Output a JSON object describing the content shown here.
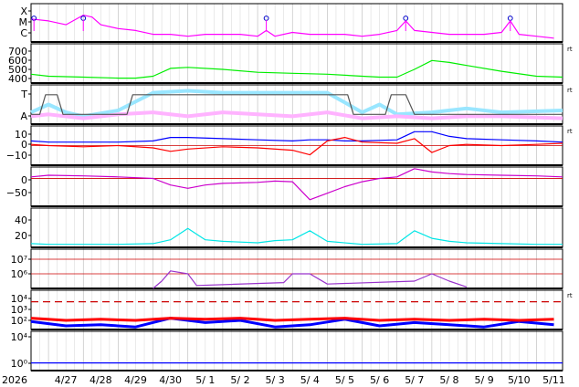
{
  "chart_data": {
    "type": "line",
    "x_axis": {
      "year_label": "2026",
      "start": "2026-04-26T12:00",
      "end": "2026-05-11T18:00",
      "tick_labels": [
        "4/27",
        "4/28",
        "4/29",
        "4/30",
        "5/ 1",
        "5/ 2",
        "5/ 3",
        "5/ 4",
        "5/ 5",
        "5/ 6",
        "5/ 7",
        "5/ 8",
        "5/ 9",
        "5/10",
        "5/11"
      ],
      "grid": true
    },
    "panels": [
      {
        "id": "xray-class",
        "y_tick_labels": [
          "X",
          "M",
          "C"
        ],
        "series": [
          {
            "color": "#ff00ff",
            "x": [
              "2026-04-26T12:00",
              "2026-04-27T00:00",
              "2026-04-27T12:00",
              "2026-04-28T00:00",
              "2026-04-28T06:00",
              "2026-04-28T12:00",
              "2026-04-29T00:00",
              "2026-04-29T12:00",
              "2026-04-30T00:00",
              "2026-04-30T12:00",
              "2026-05-01T00:00",
              "2026-05-01T12:00",
              "2026-05-02T00:00",
              "2026-05-02T12:00",
              "2026-05-03T00:00",
              "2026-05-03T06:00",
              "2026-05-03T12:00",
              "2026-05-04T00:00",
              "2026-05-04T12:00",
              "2026-05-05T00:00",
              "2026-05-05T12:00",
              "2026-05-06T00:00",
              "2026-05-06T12:00",
              "2026-05-07T00:00",
              "2026-05-07T06:00",
              "2026-05-07T12:00",
              "2026-05-08T00:00",
              "2026-05-08T12:00",
              "2026-05-09T00:00",
              "2026-05-09T12:00",
              "2026-05-10T00:00",
              "2026-05-10T06:00",
              "2026-05-10T12:00",
              "2026-05-11T00:00",
              "2026-05-11T12:00"
            ],
            "values": [
              0.6,
              0.55,
              0.45,
              0.7,
              0.65,
              0.45,
              0.35,
              0.3,
              0.2,
              0.2,
              0.15,
              0.2,
              0.2,
              0.2,
              0.15,
              0.3,
              0.15,
              0.25,
              0.2,
              0.2,
              0.2,
              0.15,
              0.2,
              0.3,
              0.55,
              0.3,
              0.25,
              0.2,
              0.2,
              0.2,
              0.25,
              0.55,
              0.2,
              0.15,
              0.1
            ]
          }
        ],
        "flare_markers": [
          "2026-04-26T14:00",
          "2026-04-28T00:00",
          "2026-05-03T06:00",
          "2026-05-07T06:00",
          "2026-05-10T06:00"
        ]
      },
      {
        "id": "solar-wind-speed",
        "y_tick_labels": [
          "700",
          "600",
          "500",
          "400"
        ],
        "ylim": [
          330,
          730
        ],
        "series": [
          {
            "color": "#00ee00",
            "x": [
              "2026-04-26T12:00",
              "2026-04-27T00:00",
              "2026-04-28T00:00",
              "2026-04-29T00:00",
              "2026-04-29T12:00",
              "2026-04-30T00:00",
              "2026-04-30T12:00",
              "2026-05-01T00:00",
              "2026-05-02T00:00",
              "2026-05-03T00:00",
              "2026-05-04T00:00",
              "2026-05-05T00:00",
              "2026-05-06T00:00",
              "2026-05-06T12:00",
              "2026-05-07T00:00",
              "2026-05-07T12:00",
              "2026-05-08T00:00",
              "2026-05-08T12:00",
              "2026-05-09T00:00",
              "2026-05-10T00:00",
              "2026-05-11T00:00",
              "2026-05-11T18:00"
            ],
            "values": [
              420,
              400,
              390,
              380,
              380,
              400,
              480,
              490,
              470,
              440,
              430,
              420,
              400,
              390,
              390,
              470,
              560,
              540,
              510,
              450,
              400,
              390
            ]
          }
        ]
      },
      {
        "id": "imf-sector",
        "y_tick_labels": [
          "T",
          "A"
        ],
        "series": [
          {
            "color": "#99e6ff",
            "x": [
              "2026-04-26T12:00",
              "2026-04-27T00:00",
              "2026-04-27T12:00",
              "2026-04-28T00:00",
              "2026-04-29T00:00",
              "2026-04-30T00:00",
              "2026-05-01T00:00",
              "2026-05-02T00:00",
              "2026-05-03T00:00",
              "2026-05-04T00:00",
              "2026-05-05T00:00",
              "2026-05-05T12:00",
              "2026-05-06T00:00",
              "2026-05-06T12:00",
              "2026-05-07T00:00",
              "2026-05-08T00:00",
              "2026-05-09T00:00",
              "2026-05-10T00:00",
              "2026-05-11T18:00"
            ],
            "values": [
              0.3,
              0.5,
              0.3,
              0.2,
              0.35,
              0.8,
              0.85,
              0.8,
              0.8,
              0.8,
              0.8,
              0.55,
              0.3,
              0.5,
              0.25,
              0.3,
              0.4,
              0.3,
              0.35
            ]
          },
          {
            "color": "#ffb3ff",
            "x": [
              "2026-04-26T12:00",
              "2026-04-27T00:00",
              "2026-04-28T00:00",
              "2026-04-29T00:00",
              "2026-04-30T00:00",
              "2026-05-01T00:00",
              "2026-05-02T00:00",
              "2026-05-03T00:00",
              "2026-05-04T00:00",
              "2026-05-05T00:00",
              "2026-05-06T00:00",
              "2026-05-07T00:00",
              "2026-05-08T00:00",
              "2026-05-09T00:00",
              "2026-05-10T00:00",
              "2026-05-11T18:00"
            ],
            "values": [
              0.2,
              0.25,
              0.15,
              0.25,
              0.3,
              0.2,
              0.3,
              0.25,
              0.2,
              0.3,
              0.15,
              0.2,
              0.15,
              0.2,
              0.2,
              0.15
            ]
          },
          {
            "color": "#555555",
            "x": [
              "2026-04-26T12:00",
              "2026-04-26T18:00",
              "2026-04-26T22:00",
              "2026-04-27T06:00",
              "2026-04-27T10:00",
              "2026-04-28T06:00",
              "2026-04-28T14:00",
              "2026-04-29T06:00",
              "2026-04-29T10:00",
              "2026-05-05T14:00",
              "2026-05-05T18:00",
              "2026-05-06T16:00",
              "2026-05-06T20:00",
              "2026-05-07T06:00",
              "2026-05-07T12:00",
              "2026-05-11T18:00"
            ],
            "values": [
              0.25,
              0.25,
              0.75,
              0.75,
              0.25,
              0.25,
              0.25,
              0.25,
              0.75,
              0.75,
              0.25,
              0.25,
              0.75,
              0.75,
              0.25,
              0.25
            ]
          }
        ]
      },
      {
        "id": "imf-components",
        "y_tick_labels": [
          "10",
          "0",
          "−10"
        ],
        "ylim": [
          -17,
          17
        ],
        "series": [
          {
            "color": "#0000ff",
            "x": [
              "2026-04-26T12:00",
              "2026-04-27T00:00",
              "2026-04-28T00:00",
              "2026-04-29T00:00",
              "2026-04-30T00:00",
              "2026-04-30T12:00",
              "2026-05-01T00:00",
              "2026-05-02T00:00",
              "2026-05-03T00:00",
              "2026-05-04T00:00",
              "2026-05-04T12:00",
              "2026-05-05T00:00",
              "2026-05-05T12:00",
              "2026-05-06T00:00",
              "2026-05-07T00:00",
              "2026-05-07T12:00",
              "2026-05-08T00:00",
              "2026-05-08T12:00",
              "2026-05-09T00:00",
              "2026-05-10T00:00",
              "2026-05-11T00:00",
              "2026-05-11T18:00"
            ],
            "values": [
              4,
              3,
              3,
              3,
              4,
              7,
              7,
              6,
              5,
              4,
              5,
              5,
              4,
              4,
              5,
              12,
              12,
              8,
              6,
              5,
              4,
              3
            ]
          },
          {
            "color": "#ff0000",
            "x": [
              "2026-04-26T12:00",
              "2026-04-27T00:00",
              "2026-04-28T00:00",
              "2026-04-29T00:00",
              "2026-04-30T00:00",
              "2026-04-30T12:00",
              "2026-05-01T00:00",
              "2026-05-02T00:00",
              "2026-05-03T00:00",
              "2026-05-04T00:00",
              "2026-05-04T12:00",
              "2026-05-05T00:00",
              "2026-05-05T12:00",
              "2026-05-06T00:00",
              "2026-05-07T00:00",
              "2026-05-07T12:00",
              "2026-05-08T00:00",
              "2026-05-08T12:00",
              "2026-05-09T00:00",
              "2026-05-10T00:00",
              "2026-05-11T00:00",
              "2026-05-11T18:00"
            ],
            "values": [
              1,
              0,
              -1,
              0,
              -2,
              -5,
              -3,
              -1,
              -2,
              -4,
              -8,
              4,
              7,
              3,
              2,
              6,
              -6,
              0,
              1,
              0,
              1,
              2
            ]
          }
        ]
      },
      {
        "id": "dst",
        "y_tick_labels": [
          "0",
          "−50"
        ],
        "ylim": [
          -85,
          35
        ],
        "series": [
          {
            "color": "#cc00cc",
            "x": [
              "2026-04-26T12:00",
              "2026-04-27T00:00",
              "2026-04-28T00:00",
              "2026-04-29T00:00",
              "2026-04-30T00:00",
              "2026-04-30T12:00",
              "2026-05-01T00:00",
              "2026-05-01T12:00",
              "2026-05-02T00:00",
              "2026-05-03T00:00",
              "2026-05-03T12:00",
              "2026-05-04T00:00",
              "2026-05-04T12:00",
              "2026-05-05T00:00",
              "2026-05-05T12:00",
              "2026-05-06T00:00",
              "2026-05-06T12:00",
              "2026-05-07T00:00",
              "2026-05-07T12:00",
              "2026-05-08T00:00",
              "2026-05-08T12:00",
              "2026-05-09T00:00",
              "2026-05-10T00:00",
              "2026-05-11T00:00",
              "2026-05-11T18:00"
            ],
            "values": [
              5,
              10,
              8,
              5,
              0,
              -20,
              -30,
              -20,
              -15,
              -12,
              -8,
              -10,
              -65,
              -45,
              -25,
              -10,
              0,
              5,
              30,
              20,
              15,
              12,
              10,
              8,
              5
            ]
          }
        ]
      },
      {
        "id": "ae-index",
        "y_tick_labels": [
          "40",
          "20"
        ],
        "ylim": [
          0,
          52
        ],
        "series": [
          {
            "color": "#00e6e6",
            "x": [
              "2026-04-26T12:00",
              "2026-04-27T00:00",
              "2026-04-28T00:00",
              "2026-04-29T00:00",
              "2026-04-30T00:00",
              "2026-04-30T12:00",
              "2026-05-01T00:00",
              "2026-05-01T12:00",
              "2026-05-02T00:00",
              "2026-05-03T00:00",
              "2026-05-03T12:00",
              "2026-05-04T00:00",
              "2026-05-04T12:00",
              "2026-05-05T00:00",
              "2026-05-06T00:00",
              "2026-05-07T00:00",
              "2026-05-07T12:00",
              "2026-05-08T00:00",
              "2026-05-08T12:00",
              "2026-05-09T00:00",
              "2026-05-10T00:00",
              "2026-05-11T00:00",
              "2026-05-11T18:00"
            ],
            "values": [
              5,
              4,
              4,
              4,
              5,
              10,
              25,
              10,
              8,
              6,
              9,
              10,
              22,
              8,
              4,
              5,
              22,
              12,
              8,
              6,
              5,
              4,
              4
            ]
          }
        ]
      },
      {
        "id": "electron-flux",
        "y_tick_labels": [
          "10⁷",
          "10⁶"
        ],
        "series": [
          {
            "color": "#9933cc",
            "x": [
              "2026-04-30T00:00",
              "2026-04-30T06:00",
              "2026-04-30T12:00",
              "2026-05-01T00:00",
              "2026-05-01T06:00",
              "2026-05-03T18:00",
              "2026-05-04T00:00",
              "2026-05-04T12:00",
              "2026-05-05T00:00",
              "2026-05-07T12:00",
              "2026-05-08T00:00",
              "2026-05-08T12:00",
              "2026-05-09T00:00"
            ],
            "values": [
              5.0,
              5.5,
              6.2,
              6.0,
              5.2,
              5.4,
              6.0,
              6.0,
              5.3,
              5.5,
              6.0,
              5.5,
              5.1
            ]
          }
        ]
      },
      {
        "id": "proton-flux",
        "y_tick_labels": [
          "10⁴",
          "10³",
          "10²"
        ],
        "series": [
          {
            "color": "#0000ff",
            "x": [
              "2026-04-26T12:00",
              "2026-04-27T12:00",
              "2026-04-28T12:00",
              "2026-04-29T12:00",
              "2026-04-30T12:00",
              "2026-05-01T12:00",
              "2026-05-02T12:00",
              "2026-05-03T12:00",
              "2026-05-04T12:00",
              "2026-05-05T12:00",
              "2026-05-06T12:00",
              "2026-05-07T12:00",
              "2026-05-08T12:00",
              "2026-05-09T12:00",
              "2026-05-10T12:00",
              "2026-05-11T12:00"
            ],
            "values": [
              1.9,
              1.5,
              1.6,
              1.4,
              2.2,
              1.8,
              2.0,
              1.4,
              1.6,
              2.1,
              1.5,
              1.8,
              1.6,
              1.4,
              1.9,
              1.6
            ]
          },
          {
            "color": "#ff0000",
            "x": [
              "2026-04-26T12:00",
              "2026-04-27T12:00",
              "2026-04-28T12:00",
              "2026-04-29T12:00",
              "2026-04-30T12:00",
              "2026-05-01T12:00",
              "2026-05-02T12:00",
              "2026-05-03T12:00",
              "2026-05-04T12:00",
              "2026-05-05T12:00",
              "2026-05-06T12:00",
              "2026-05-07T12:00",
              "2026-05-08T12:00",
              "2026-05-09T12:00",
              "2026-05-10T12:00",
              "2026-05-11T12:00"
            ],
            "values": [
              2.2,
              2.0,
              2.1,
              2.0,
              2.2,
              2.1,
              2.2,
              2.0,
              2.1,
              2.2,
              2.0,
              2.1,
              2.0,
              2.1,
              2.0,
              2.1
            ]
          }
        ],
        "threshold": 3.7
      },
      {
        "id": "proton-high",
        "y_tick_labels": [
          "10⁴",
          "10⁰"
        ],
        "series": [
          {
            "color": "#0000ff",
            "x": [
              "2026-04-26T12:00",
              "2026-05-11T18:00"
            ],
            "values": [
              0.05,
              0.05
            ]
          }
        ]
      }
    ]
  }
}
